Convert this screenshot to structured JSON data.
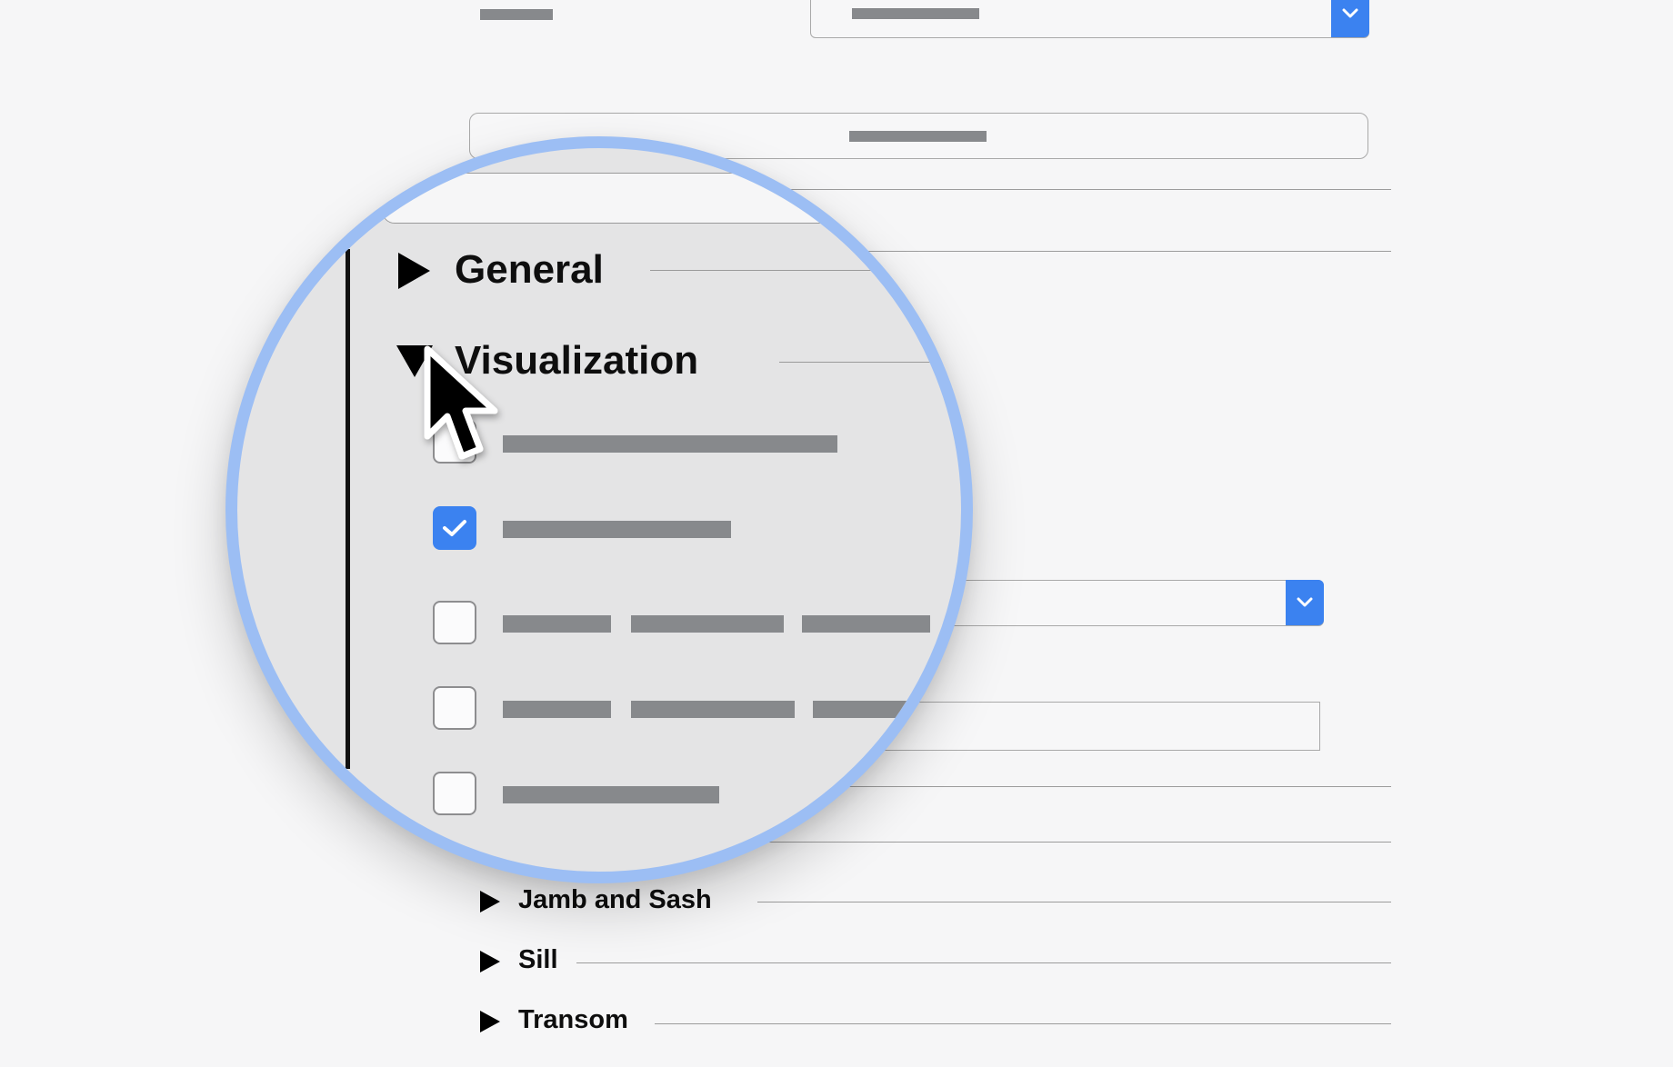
{
  "panel": {
    "sections": {
      "general": {
        "label": "General",
        "expanded": false
      },
      "visualization": {
        "label": "Visualization",
        "expanded": true,
        "options": [
          {
            "checked": false
          },
          {
            "checked": true
          },
          {
            "checked": false
          },
          {
            "checked": false
          },
          {
            "checked": false
          }
        ]
      },
      "jamb_and_sash": {
        "label": "Jamb and Sash",
        "expanded": false
      },
      "sill": {
        "label": "Sill",
        "expanded": false
      },
      "transom": {
        "label": "Transom",
        "expanded": false
      }
    }
  },
  "icons": {
    "expand": "triangle-right-icon",
    "collapse": "triangle-down-icon",
    "dropdown": "chevron-down-icon",
    "check": "checkmark-icon",
    "pointer": "mouse-pointer-icon"
  },
  "colors": {
    "accent": "#3b82f0",
    "magnifier_ring": "#9cbef4",
    "magnifier_bg": "#e4e4e5",
    "background": "#f6f6f7",
    "placeholder_text": "#87898c"
  }
}
